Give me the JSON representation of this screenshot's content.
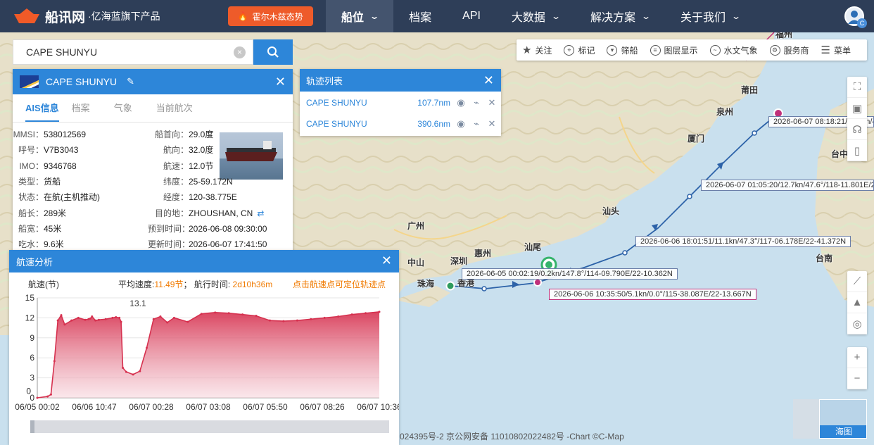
{
  "brand": {
    "name": "船讯网",
    "sub": "·亿海蓝旗下产品",
    "promo": "霍尔木兹态势",
    "logo_color": "#f05a28"
  },
  "nav": [
    {
      "label": "船位",
      "dropdown": true,
      "active": true
    },
    {
      "label": "档案",
      "dropdown": false
    },
    {
      "label": "API",
      "dropdown": false
    },
    {
      "label": "大数据",
      "dropdown": true
    },
    {
      "label": "解决方案",
      "dropdown": true
    },
    {
      "label": "关于我们",
      "dropdown": true
    }
  ],
  "user": {
    "badge": "C"
  },
  "search": {
    "value": "CAPE SHUNYU"
  },
  "ship": {
    "name": "CAPE SHUNYU",
    "tabs": [
      "AIS信息",
      "档案",
      "气象",
      "当前航次"
    ],
    "left": [
      {
        "k": "MMSI：",
        "v": "538012569"
      },
      {
        "k": "呼号：",
        "v": "V7B3043"
      },
      {
        "k": "IMO：",
        "v": "9346768"
      },
      {
        "k": "类型：",
        "v": "货船"
      },
      {
        "k": "状态：",
        "v": "在航(主机推动)"
      },
      {
        "k": "船长：",
        "v": "289米"
      },
      {
        "k": "船宽：",
        "v": "45米"
      },
      {
        "k": "吃水：",
        "v": "9.6米"
      }
    ],
    "right": [
      {
        "k": "船首向：",
        "v": "29.0度"
      },
      {
        "k": "航向：",
        "v": "32.0度"
      },
      {
        "k": "航速：",
        "v": "12.0节"
      },
      {
        "k": "纬度：",
        "v": "25-59.172N"
      },
      {
        "k": "经度：",
        "v": "120-38.775E"
      },
      {
        "k": "目的地：",
        "v": "ZHOUSHAN, CN"
      },
      {
        "k": "预到时间：",
        "v": "2026-06-08 09:30:00"
      },
      {
        "k": "更新时间：",
        "v": "2026-06-07 17:41:50"
      }
    ]
  },
  "speed": {
    "title": "航速分析",
    "ylabel": "航速(节)",
    "avg_label": "平均速度:",
    "avg_value": "11.49节",
    "sep": "；",
    "time_label": "航行时间:",
    "time_value": "2d10h36m",
    "hint": "点击航速点可定位轨迹点",
    "max_label": "13.1"
  },
  "chart_data": {
    "type": "area",
    "title": "",
    "xlabel": "",
    "ylabel": "航速(节)",
    "ylim": [
      0,
      15
    ],
    "yticks": [
      "0",
      "3",
      "6",
      "9",
      "12",
      "15"
    ],
    "xticks": [
      "06/05 00:02",
      "06/06 10:47",
      "06/07 00:28",
      "06/07 03:08",
      "06/07 05:50",
      "06/07 08:26",
      "06/07 10:36"
    ],
    "annotations": [
      "13.1",
      "0"
    ],
    "color": "#d6314f",
    "x": [
      0,
      0.03,
      0.04,
      0.05,
      0.06,
      0.07,
      0.08,
      0.1,
      0.12,
      0.14,
      0.15,
      0.155,
      0.16,
      0.17,
      0.18,
      0.2,
      0.22,
      0.23,
      0.24,
      0.245,
      0.25,
      0.26,
      0.28,
      0.3,
      0.32,
      0.34,
      0.36,
      0.38,
      0.4,
      0.44,
      0.48,
      0.52,
      0.56,
      0.6,
      0.64,
      0.68,
      0.72,
      0.76,
      0.8,
      0.84,
      0.88,
      0.92,
      0.96,
      1.0
    ],
    "values": [
      0,
      0.2,
      0.5,
      5.5,
      11.6,
      12.4,
      11.0,
      11.6,
      12.0,
      11.7,
      11.8,
      11.9,
      12.2,
      11.6,
      11.7,
      11.8,
      12.0,
      12.1,
      12.0,
      11.4,
      4.5,
      3.9,
      3.5,
      4.0,
      7.5,
      11.8,
      12.2,
      11.3,
      12.0,
      11.4,
      12.6,
      12.8,
      12.7,
      12.5,
      12.3,
      11.6,
      11.5,
      11.6,
      11.8,
      12.0,
      12.2,
      12.5,
      12.7,
      12.9
    ]
  },
  "track_list": {
    "title": "轨迹列表",
    "rows": [
      {
        "name": "CAPE SHUNYU",
        "dist": "107.7nm"
      },
      {
        "name": "CAPE SHUNYU",
        "dist": "390.6nm"
      }
    ]
  },
  "toolbar": [
    "关注",
    "标记",
    "筛船",
    "图层显示",
    "水文气象",
    "服务商",
    "菜单"
  ],
  "map": {
    "places": [
      "莆田",
      "泉州",
      "厦门",
      "台中",
      "汕头",
      "广州",
      "汕尾",
      "惠州",
      "深圳",
      "中山",
      "珠海",
      "香港",
      "台南",
      "福州"
    ],
    "track_labels": [
      "2026-06-07 08:18:21/11.8kn/4",
      "2026-06-07 01:05:20/12.7kn/47.6°/118-11.801E/2",
      "2026-06-06 18:01:51/11.1kn/47.3°/117-06.178E/22-41.372N",
      "2026-06-05 00:02:19/0.2kn/147.8°/114-09.790E/22-10.362N",
      "2026-06-06 10:35:50/5.1kn/0.0°/115-38.087E/22-13.667N"
    ],
    "footer": "024395号-2   京公网安备 11010802022482号   -Chart ©C-Map",
    "minimap_label": "海图",
    "zoom_in": "+",
    "zoom_out": "−"
  }
}
